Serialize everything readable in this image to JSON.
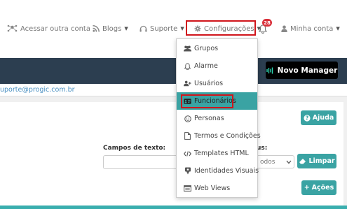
{
  "topbar": {
    "acessar": "Acessar outra conta",
    "blogs": "Blogs",
    "suporte": "Suporte",
    "configuracoes": "Configurações",
    "notifications_count": "28",
    "minha_conta": "Minha conta"
  },
  "header": {
    "novo_manager": "Novo Manager"
  },
  "info": {
    "email": "uporte@progic.com.br"
  },
  "panel": {
    "ajuda": "Ajuda",
    "campos_label": "Campos de texto:",
    "campos_value": "",
    "status_label": "us:",
    "status_select": "odos",
    "limpar": "Limpar",
    "acoes": "Ações"
  },
  "dropdown": {
    "items": [
      {
        "label": "Grupos",
        "icon": "users-icon"
      },
      {
        "label": "Alarme",
        "icon": "bell-icon"
      },
      {
        "label": "Usuários",
        "icon": "user-plus-icon"
      },
      {
        "label": "Funcionários",
        "icon": "id-card-icon",
        "active": true
      },
      {
        "label": "Personas",
        "icon": "smile-icon"
      },
      {
        "label": "Termos e Condições",
        "icon": "file-icon"
      },
      {
        "label": "Templates HTML",
        "icon": "code-icon"
      },
      {
        "label": "Identidades Visuais",
        "icon": "brand-icon"
      },
      {
        "label": "Web Views",
        "icon": "window-icon"
      }
    ]
  },
  "colors": {
    "teal": "#3aa3a3",
    "dark_header": "#2c3e50",
    "highlight_red": "#d0151b",
    "link_blue": "#4a90c2"
  }
}
